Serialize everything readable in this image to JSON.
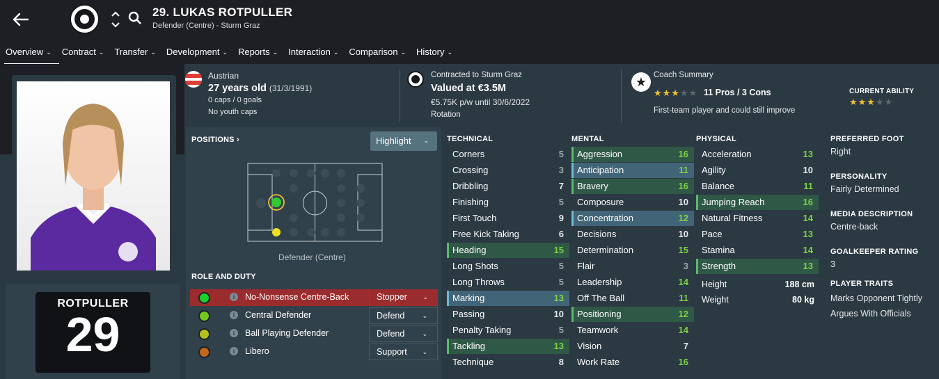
{
  "header": {
    "player_name": "29. LUKAS ROTPULLER",
    "subtitle": "Defender (Centre) - Sturm Graz"
  },
  "nav": [
    {
      "label": "Overview",
      "active": true
    },
    {
      "label": "Contract"
    },
    {
      "label": "Transfer"
    },
    {
      "label": "Development"
    },
    {
      "label": "Reports"
    },
    {
      "label": "Interaction"
    },
    {
      "label": "Comparison"
    },
    {
      "label": "History"
    }
  ],
  "info": {
    "nationality": "Austrian",
    "age": "27 years old",
    "dob": "(31/3/1991)",
    "caps": "0 caps / 0 goals",
    "youth_caps": "No youth caps",
    "contract": "Contracted to Sturm Graz",
    "value": "Valued at €3.5M",
    "wage": "€5.75K p/w until 30/6/2022",
    "squad_status": "Rotation",
    "coach_title": "Coach Summary",
    "coach_stars": 3,
    "pros_cons": "11 Pros / 3 Cons",
    "coach_text": "First-team player and could still improve",
    "ca_label": "CURRENT ABILITY",
    "ca_stars": 3,
    "star_color": "#f2c033"
  },
  "jersey": {
    "name": "ROTPULLER",
    "number": "29"
  },
  "positions": {
    "title": "POSITIONS",
    "highlight_label": "Highlight",
    "position_label": "Defender (Centre)"
  },
  "roles": {
    "title": "ROLE AND DUTY",
    "items": [
      {
        "name": "No-Nonsense Centre-Back",
        "duty": "Stopper",
        "color": "#18d12a",
        "selected": true
      },
      {
        "name": "Central Defender",
        "duty": "Defend",
        "color": "#74c91e"
      },
      {
        "name": "Ball Playing Defender",
        "duty": "Defend",
        "color": "#b5c21c"
      },
      {
        "name": "Libero",
        "duty": "Support",
        "color": "#c26a1c"
      }
    ]
  },
  "technical": {
    "title": "TECHNICAL",
    "items": [
      {
        "name": "Corners",
        "value": "5"
      },
      {
        "name": "Crossing",
        "value": "3"
      },
      {
        "name": "Dribbling",
        "value": "7"
      },
      {
        "name": "Finishing",
        "value": "5"
      },
      {
        "name": "First Touch",
        "value": "9"
      },
      {
        "name": "Free Kick Taking",
        "value": "6"
      },
      {
        "name": "Heading",
        "value": "15",
        "hl": "green"
      },
      {
        "name": "Long Shots",
        "value": "5"
      },
      {
        "name": "Long Throws",
        "value": "5"
      },
      {
        "name": "Marking",
        "value": "13",
        "hl": "blue"
      },
      {
        "name": "Passing",
        "value": "10"
      },
      {
        "name": "Penalty Taking",
        "value": "5"
      },
      {
        "name": "Tackling",
        "value": "13",
        "hl": "green"
      },
      {
        "name": "Technique",
        "value": "8"
      }
    ]
  },
  "mental": {
    "title": "MENTAL",
    "items": [
      {
        "name": "Aggression",
        "value": "16",
        "hl": "green"
      },
      {
        "name": "Anticipation",
        "value": "11",
        "hl": "blue"
      },
      {
        "name": "Bravery",
        "value": "16",
        "hl": "green"
      },
      {
        "name": "Composure",
        "value": "10"
      },
      {
        "name": "Concentration",
        "value": "12",
        "hl": "blue"
      },
      {
        "name": "Decisions",
        "value": "10"
      },
      {
        "name": "Determination",
        "value": "15"
      },
      {
        "name": "Flair",
        "value": "3"
      },
      {
        "name": "Leadership",
        "value": "14"
      },
      {
        "name": "Off The Ball",
        "value": "11"
      },
      {
        "name": "Positioning",
        "value": "12",
        "hl": "green"
      },
      {
        "name": "Teamwork",
        "value": "14"
      },
      {
        "name": "Vision",
        "value": "7"
      },
      {
        "name": "Work Rate",
        "value": "16"
      }
    ]
  },
  "physical": {
    "title": "PHYSICAL",
    "items": [
      {
        "name": "Acceleration",
        "value": "13"
      },
      {
        "name": "Agility",
        "value": "10"
      },
      {
        "name": "Balance",
        "value": "11"
      },
      {
        "name": "Jumping Reach",
        "value": "16",
        "hl": "green"
      },
      {
        "name": "Natural Fitness",
        "value": "14"
      },
      {
        "name": "Pace",
        "value": "13"
      },
      {
        "name": "Stamina",
        "value": "14"
      },
      {
        "name": "Strength",
        "value": "13",
        "hl": "green"
      }
    ],
    "height_label": "Height",
    "height": "188 cm",
    "weight_label": "Weight",
    "weight": "80 kg"
  },
  "side": {
    "foot_title": "PREFERRED FOOT",
    "foot": "Right",
    "personality_title": "PERSONALITY",
    "personality": "Fairly Determined",
    "media_title": "MEDIA DESCRIPTION",
    "media": "Centre-back",
    "gk_title": "GOALKEEPER RATING",
    "gk": "3",
    "traits_title": "PLAYER TRAITS",
    "traits": [
      "Marks Opponent Tightly",
      "Argues With Officials"
    ]
  }
}
